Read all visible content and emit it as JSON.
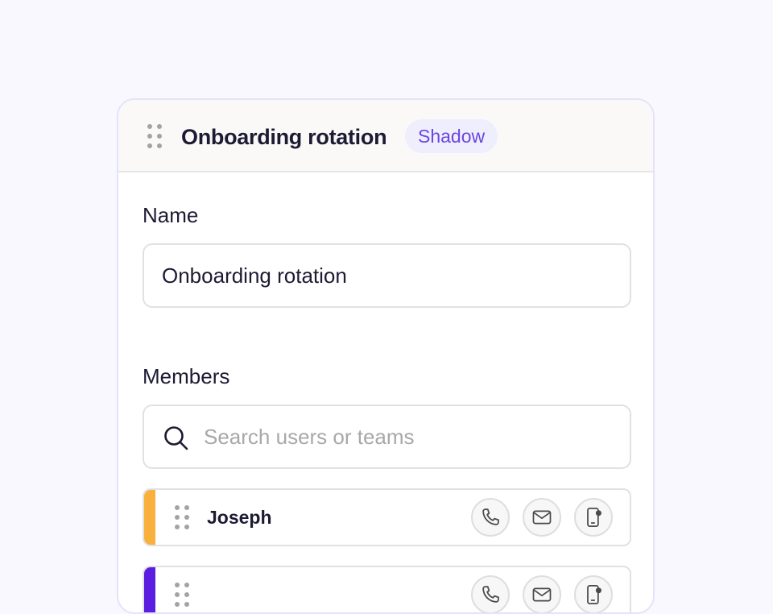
{
  "header": {
    "title": "Onboarding rotation",
    "badge": "Shadow"
  },
  "form": {
    "name_label": "Name",
    "name_value": "Onboarding rotation",
    "members_label": "Members",
    "search_placeholder": "Search users or teams"
  },
  "members": [
    {
      "name": "Joseph",
      "accent_color": "#f8b13c",
      "actions": [
        "phone-icon",
        "mail-icon",
        "mobile-notification-icon"
      ]
    },
    {
      "name": "",
      "accent_color": "#5a1ee0",
      "actions": [
        "phone-icon",
        "mail-icon",
        "mobile-notification-icon"
      ]
    }
  ],
  "colors": {
    "background": "#f8f8fe",
    "card_border": "#e4e3fa",
    "badge_bg": "#efeefc",
    "badge_text": "#6b46e0"
  }
}
